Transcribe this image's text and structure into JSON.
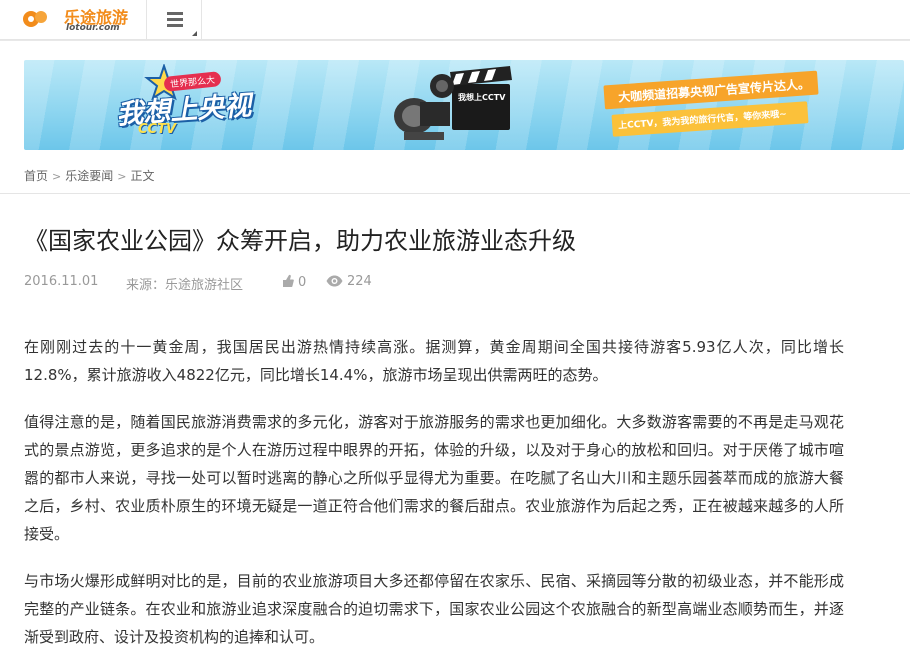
{
  "header": {
    "logo_cn": "乐途旅游",
    "logo_en": "lotour.com",
    "menu_icon": "hamburger-menu-icon"
  },
  "banner": {
    "tag": "世界那么大",
    "slogan": "我想上央视",
    "cctv": "CCTV",
    "board_text": "我想上CCTV",
    "ribbon1": "大咖频道招募央视广告宣传片达人。",
    "ribbon2": "上CCTV，我为我的旅行代言，等你来哦~"
  },
  "breadcrumb": {
    "home": "首页",
    "section": "乐途要闻",
    "current": "正文"
  },
  "article": {
    "title": "《国家农业公园》众筹开启，助力农业旅游业态升级",
    "date": "2016.11.01",
    "source": "来源：乐途旅游社区",
    "likes": "0",
    "views": "224",
    "paragraphs": [
      "在刚刚过去的十一黄金周，我国居民出游热情持续高涨。据测算，黄金周期间全国共接待游客5.93亿人次，同比增长12.8%，累计旅游收入4822亿元，同比增长14.4%，旅游市场呈现出供需两旺的态势。",
      " 值得注意的是，随着国民旅游消费需求的多元化，游客对于旅游服务的需求也更加细化。大多数游客需要的不再是走马观花式的景点游览，更多追求的是个人在游历过程中眼界的开拓，体验的升级，以及对于身心的放松和回归。对于厌倦了城市喧嚣的都市人来说，寻找一处可以暂时逃离的静心之所似乎显得尤为重要。在吃腻了名山大川和主题乐园荟萃而成的旅游大餐之后，乡村、农业质朴原生的环境无疑是一道正符合他们需求的餐后甜点。农业旅游作为后起之秀，正在被越来越多的人所接受。",
      " 与市场火爆形成鲜明对比的是，目前的农业旅游项目大多还都停留在农家乐、民宿、采摘园等分散的初级业态，并不能形成完整的产业链条。在农业和旅游业追求深度融合的迫切需求下，国家农业公园这个农旅融合的新型高端业态顺势而生，并逐渐受到政府、设计及投资机构的追捧和认可。"
    ]
  },
  "colors": {
    "brand_orange": "#f28c1b",
    "text_dark": "#222222",
    "text_meta": "#999999"
  }
}
